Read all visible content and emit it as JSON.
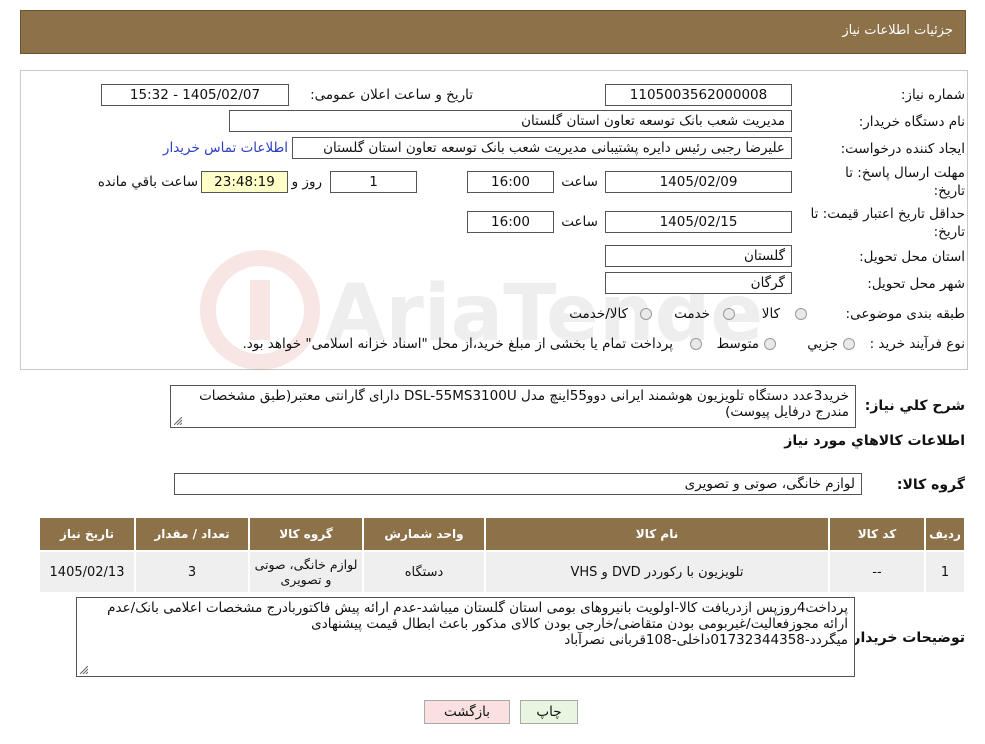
{
  "header": {
    "title": "جزئیات اطلاعات نیاز"
  },
  "fields": {
    "need_number": {
      "label": "شماره نیاز:",
      "value": "1105003562000008"
    },
    "announce": {
      "label": "تاریخ و ساعت اعلان عمومی:",
      "value": "1405/02/07 - 15:32"
    },
    "buyer_org": {
      "label": "نام دستگاه خریدار:",
      "value": "مدیریت شعب بانک توسعه تعاون استان گلستان"
    },
    "requester": {
      "label": "ایجاد کننده درخواست:",
      "value": "علیرضا رجبی رئیس دایره پشتیبانی مدیریت شعب بانک توسعه تعاون استان گلستان",
      "contact_link": "اطلاعات تماس خریدار"
    },
    "deadline": {
      "label_line1": "مهلت ارسال پاسخ: تا",
      "label_line2": "تاریخ:",
      "date": "1405/02/09",
      "time_label": "ساعت",
      "time": "16:00",
      "days": "1",
      "days_label": "روز و",
      "remaining": "23:48:19",
      "remaining_label": "ساعت باقي مانده"
    },
    "price_validity": {
      "label_line1": "حداقل تاریخ اعتبار قیمت: تا",
      "label_line2": "تاریخ:",
      "date": "1405/02/15",
      "time_label": "ساعت",
      "time": "16:00"
    },
    "province": {
      "label": "استان محل تحویل:",
      "value": "گلستان"
    },
    "city": {
      "label": "شهر محل تحویل:",
      "value": "گرگان"
    },
    "category": {
      "label": "طبقه بندی موضوعی:",
      "options": [
        "کالا",
        "خدمت",
        "کالا/خدمت"
      ]
    },
    "purchase_type": {
      "label": "نوع فرآیند خرید :",
      "options": [
        "جزیي",
        "متوسط"
      ],
      "note": "پرداخت تمام یا بخشی از مبلغ خرید،از محل \"اسناد خزانه اسلامی\" خواهد بود."
    }
  },
  "description": {
    "label": "شرح کلي نياز:",
    "value": "خرید3عدد دستگاه تلویزیون هوشمند ایرانی دوو55اینچ مدل DSL-55MS3100U دارای گارانتی معتبر(طبق مشخصات مندرج درفایل پیوست)"
  },
  "goods_info": {
    "title": "اطلاعات کالاهاي مورد نياز"
  },
  "goods_group": {
    "label": "گروه کالا:",
    "value": "لوازم خانگی، صوتی و تصویری"
  },
  "table": {
    "headers": [
      "رديف",
      "کد کالا",
      "نام کالا",
      "واحد شمارش",
      "گروه کالا",
      "تعداد / مقدار",
      "تاريخ نياز"
    ],
    "rows": [
      [
        "1",
        "--",
        "تلویزیون با رکوردر DVD و VHS",
        "دستگاه",
        "لوازم خانگی، صوتی و تصویری",
        "3",
        "1405/02/13"
      ]
    ]
  },
  "buyer_notes": {
    "label": "توضیحات خریدار:",
    "value": "پرداخت4روزپس ازدریافت کالا-اولویت بانیروهای بومی  استان گلستان میباشد-عدم ارائه پیش فاکتوربادرج مشخصات اعلامی بانک/عدم ارائه مجوزفعالیت/غیربومی بودن متقاضی/خارجی بودن کالای مذکور باعث ابطال قیمت پیشنهادی میگردد-01732344358داخلی-108قربانی نصرآباد"
  },
  "buttons": {
    "print": "چاپ",
    "back": "بازگشت"
  },
  "watermark": "AriaTender.neT"
}
